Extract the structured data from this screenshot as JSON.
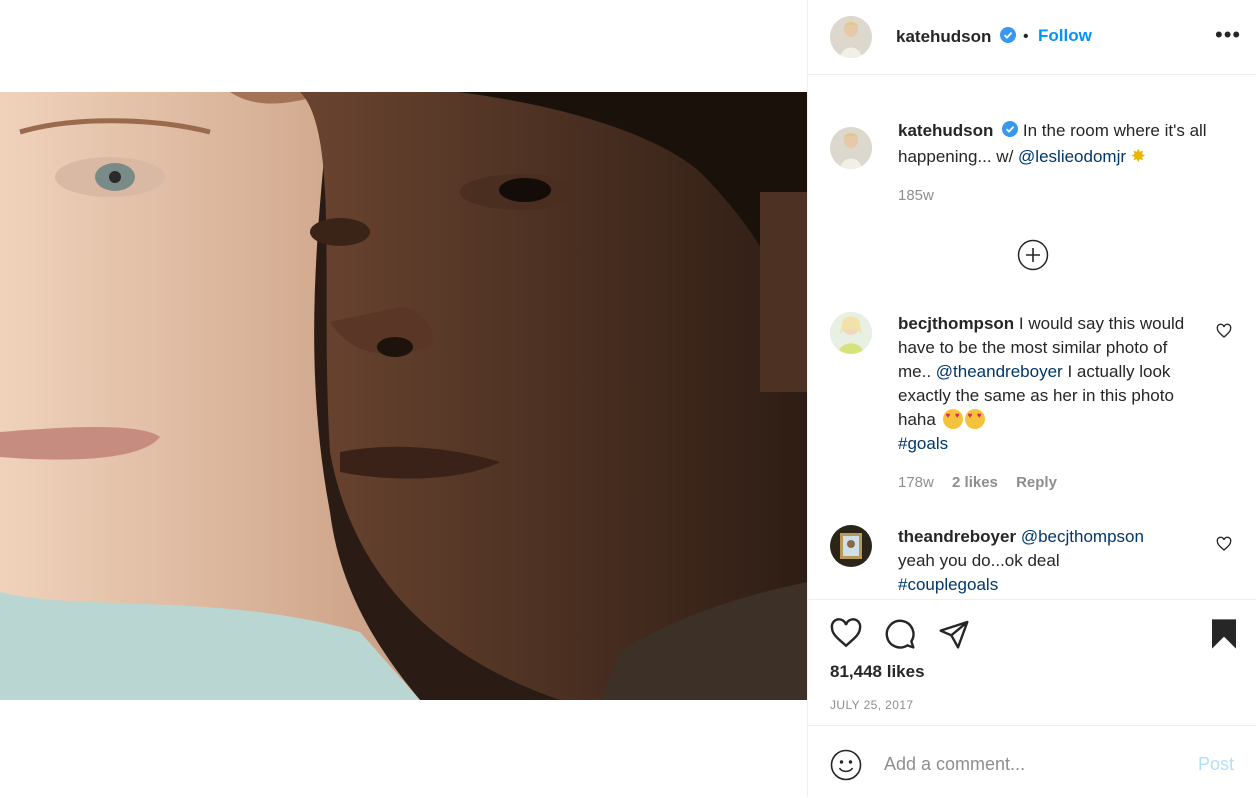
{
  "header": {
    "username": "katehudson",
    "separator": "•",
    "follow_label": "Follow",
    "more": "•••"
  },
  "caption": {
    "username": "katehudson",
    "text": "In the room where it's all happening... w/",
    "mention": "@leslieodomjr",
    "emoji": "✸",
    "time": "185w"
  },
  "comments": [
    {
      "username": "becjthompson",
      "text_a": "I would say this would have to be the most similar photo of me..",
      "mention": "@theandreboyer",
      "text_b": "I actually look exactly the same as her in this photo haha",
      "hashtag": "#goals",
      "time": "178w",
      "likes": "2 likes",
      "reply": "Reply"
    },
    {
      "username": "theandreboyer",
      "mention": "@becjthompson",
      "text": "yeah you do...ok deal",
      "hashtag": "#couplegoals"
    }
  ],
  "actions": {
    "likes": "81,448 likes",
    "date": "JULY 25, 2017"
  },
  "add_comment": {
    "placeholder": "Add a comment...",
    "post_label": "Post"
  },
  "colors": {
    "link": "#00376b",
    "follow": "#0095f6",
    "post": "#b2dffc",
    "verified": "#3897f0"
  }
}
